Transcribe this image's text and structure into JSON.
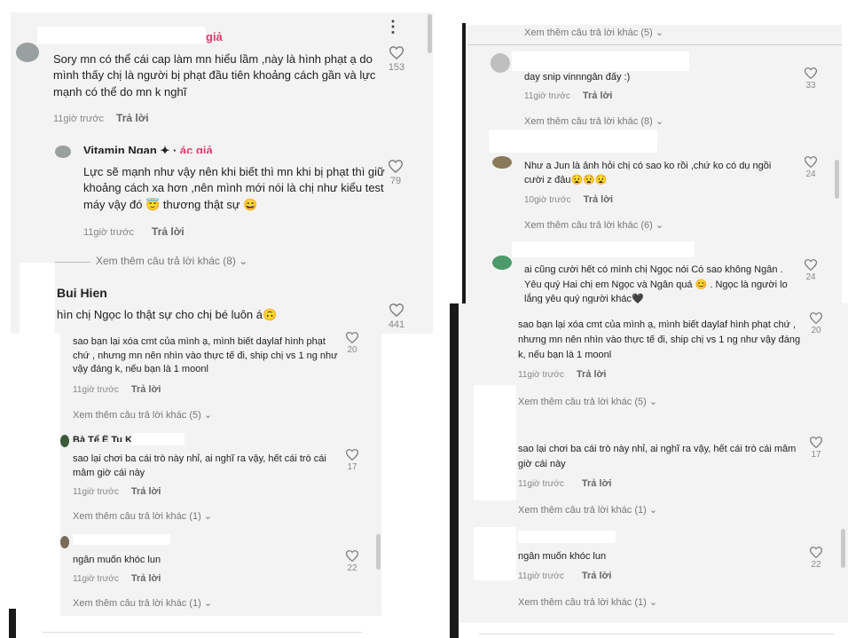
{
  "colors": {
    "accent_pink": "#e03a6b",
    "panel_bg": "#f3f3f3",
    "meta_gray": "#888888"
  },
  "icons": {
    "like": "heart-outline-icon",
    "chevron": "chevron-down-icon",
    "more": "three-dots-icon"
  },
  "panel1": {
    "c1": {
      "author_tag": "giả",
      "text": "Sory mn có thể cái cap làm mn hiểu lầm ,này là hình phạt ạ do mình thấy chị là người bị phạt đầu tiên khoảng cách gần và lực mạnh có thể do mn k nghĩ",
      "time": "11giờ trước",
      "reply": "Trả lời",
      "likes": "153"
    },
    "c2": {
      "author": "Vitamin Ngan",
      "author_tag": "ác giả",
      "text": "Lực sẽ mạnh như vậy nên khi biết thì mn khi bị phạt thì giữ khoảng cách xa hơn ,nên mình mới nói là chị như kiểu test máy vậy đó 😇 thương thật sự 😄",
      "time": "11giờ trước",
      "reply": "Trả lời",
      "likes": "79"
    },
    "more": "Xem thêm câu trả lời khác (8)",
    "c3": {
      "author": "Bui Hien",
      "text": "hìn chị Ngọc lo thật sự cho chị bé luôn á🙃",
      "likes": "441"
    }
  },
  "panel2": {
    "c1": {
      "text": "sao bạn lại xóa cmt của mình ạ, mình biết daylaf hình phạt chứ , nhưng mn nên nhìn vào thực tế đi, ship chị vs 1 ng như vậy đáng k, nếu bạn là 1 moonl",
      "time": "11giờ trước",
      "reply": "Trả lời",
      "likes": "20"
    },
    "more1": "Xem thêm câu trả lời khác (5)",
    "c2": {
      "author": "Bà Tể Ê Tu Ku Zề",
      "text": "sao lại chơi ba cái trò này nhỉ, ai nghĩ ra vậy, hết cái trò cái mâm giờ cái này",
      "time": "11giờ trước",
      "reply": "Trả lời",
      "likes": "17"
    },
    "more2": "Xem thêm câu trả lời khác (1)",
    "c3": {
      "text": "ngân muốn khóc lun",
      "time": "11giờ trước",
      "reply": "Trả lời",
      "likes": "22"
    },
    "more3": "Xem thêm câu trả lời khác (1)"
  },
  "panel3": {
    "more0": "Xem thêm câu trả lời khác (5)",
    "c1": {
      "text": "day snip vinnngân đấy :)",
      "time": "11giờ trước",
      "reply": "Trả lời",
      "likes": "33"
    },
    "more1": "Xem thêm câu trả lời khác (8)",
    "c2": {
      "text": "Như a Jun là ảnh hỏi chị có sao ko rồi ,chứ ko có dụ ngồi cười z đâu😧😧😧",
      "time": "10giờ trước",
      "reply": "Trả lời",
      "likes": "24"
    },
    "more2": "Xem thêm câu trả lời khác (6)",
    "c3": {
      "text": "ai cũng cười hết có mình chị Ngọc nói Có sao không Ngân . Yêu quý Hai chị em Ngọc và Ngân quá 😊 . Ngọc là người lo lắng yêu quý người khác🖤",
      "likes": "24"
    }
  },
  "panel4": {
    "c1": {
      "text": "sao bạn lại xóa cmt của mình ạ, mình biết daylaf hình phạt chứ , nhưng mn nên nhìn vào thực tế đi, ship chị vs 1 ng như vậy đáng k, nếu bạn là 1 moonl",
      "time": "11giờ trước",
      "reply": "Trả lời",
      "likes": "20"
    },
    "more1": "Xem thêm câu trả lời khác (5)",
    "c2": {
      "text": "sao lại chơi ba cái trò này nhỉ, ai nghĩ ra vậy, hết cái trò cái mâm giờ cái này",
      "time": "11giờ trước",
      "reply": "Trả lời",
      "likes": "17"
    },
    "more2": "Xem thêm câu trả lời khác (1)",
    "c3": {
      "text": "ngân muốn khóc lun",
      "time": "11giờ trước",
      "reply": "Trả lời",
      "likes": "22"
    },
    "more3": "Xem thêm câu trả lời khác (1)"
  }
}
